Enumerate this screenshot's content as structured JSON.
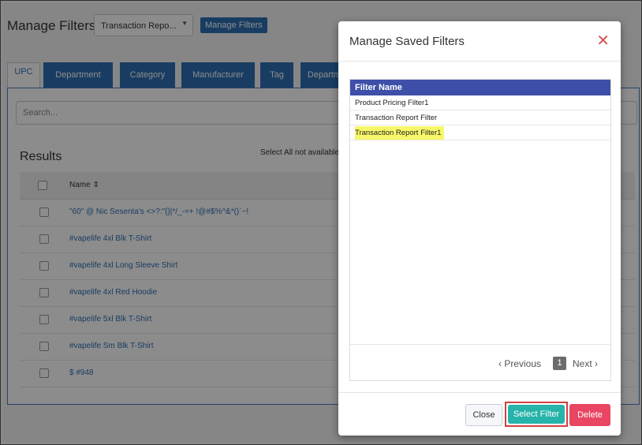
{
  "page": {
    "title": "Manage Filters",
    "report_select": "Transaction Repo...",
    "manage_filters_btn": "Manage Filters",
    "tabs": [
      "UPC",
      "Department",
      "Category",
      "Manufacturer",
      "Tag",
      "Departm"
    ],
    "search_placeholder": "Search...",
    "results_label": "Results",
    "select_all_text": "Select All not available",
    "name_header": "Name",
    "rows": [
      "\"60\" @ Nic Sesenta's <>?:\"{}|*/_-=+ !@#$%^&*()`~!",
      "#vapelife 4xl Blk T-Shirt",
      "#vapelife 4xl Long Sleeve Shirt",
      "#vapelife 4xl Red Hoodie",
      "#vapelife 5xl Blk T-Shirt",
      "#vapelife Sm Blk T-Shirt",
      "$ #948"
    ]
  },
  "modal": {
    "title": "Manage Saved Filters",
    "column_header": "Filter Name",
    "filters": [
      "Product Pricing Filter1",
      "Transaction Report Filter",
      "Transaction Report Filter1"
    ],
    "highlighted_index": 2,
    "pager": {
      "previous": "Previous",
      "page": "1",
      "next": "Next"
    },
    "buttons": {
      "close": "Close",
      "select": "Select Filter",
      "delete": "Delete"
    }
  }
}
